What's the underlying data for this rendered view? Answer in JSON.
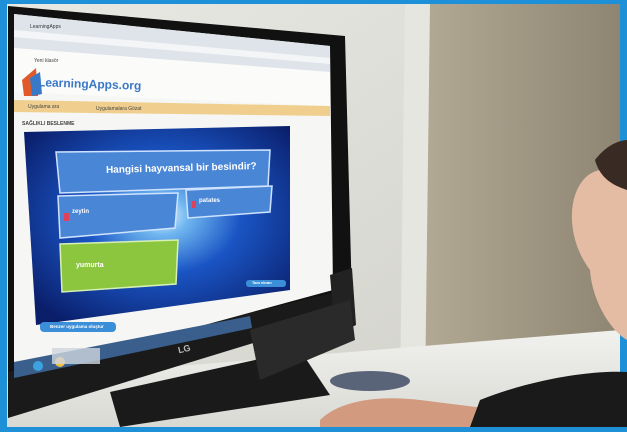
{
  "browser": {
    "tab_title": "LearningApps",
    "bookmarks": "Yeni klasör"
  },
  "site": {
    "logo_text": "LearningApps.org",
    "search_placeholder": "Uygulama ara",
    "nav_link": "Uygulamalara Gözat",
    "page_heading": "SAĞLIKLI BESLENME"
  },
  "quiz": {
    "question": "Hangisi hayvansal bir besindir?",
    "answers": [
      {
        "label": "zeytin",
        "state": "wrong"
      },
      {
        "label": "patates",
        "state": "wrong"
      },
      {
        "label": "yumurta",
        "state": "correct"
      }
    ]
  },
  "buttons": {
    "next_label": "Tam ekran",
    "bottom_label": "Benzer uygulama oluştur"
  },
  "monitor": {
    "brand": "LG"
  },
  "colors": {
    "frame": "#1e90d8",
    "answer_box": "#4a86d6",
    "correct": "#8cc63f",
    "wrong_marker": "#e0405a"
  }
}
